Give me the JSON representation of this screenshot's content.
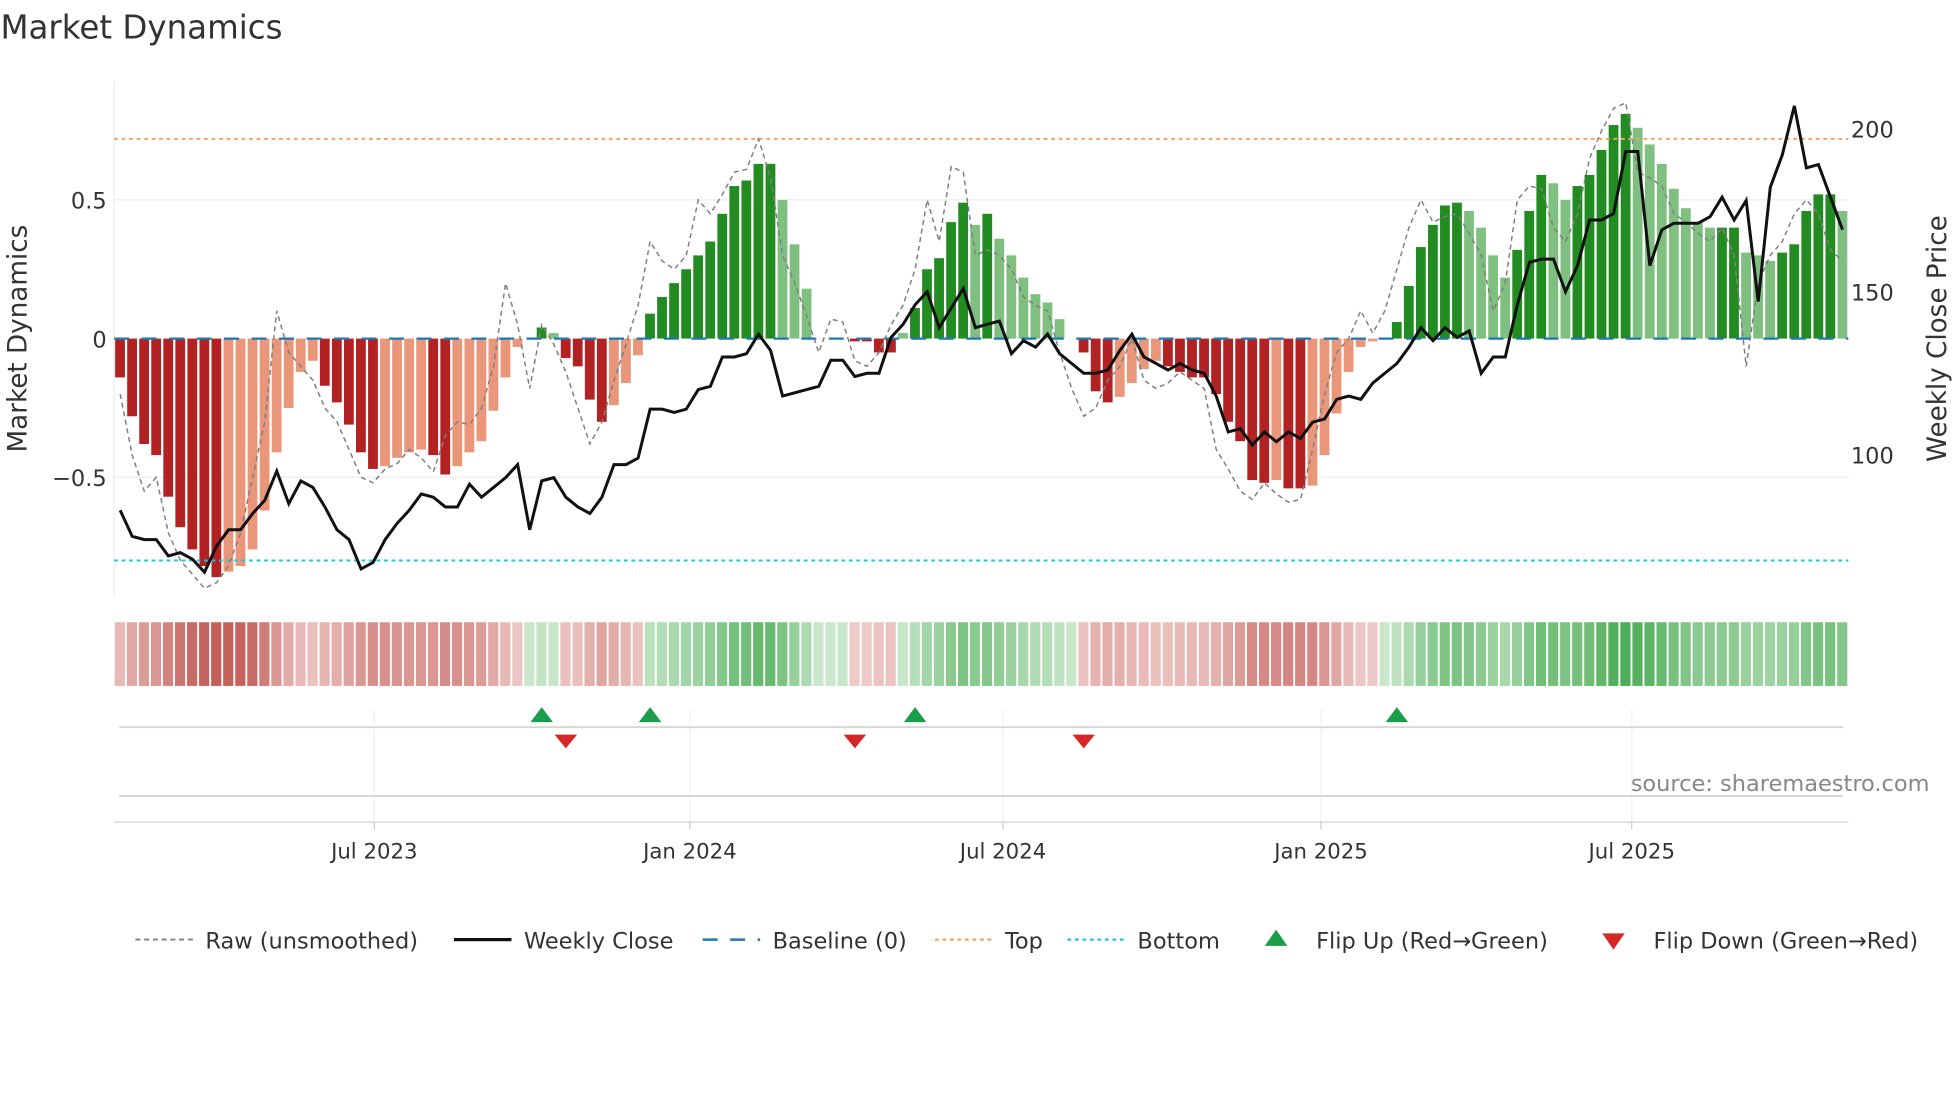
{
  "chart_data": {
    "type": "bar",
    "title": "Market Dynamics",
    "ylabel": "Market Dynamics",
    "ylabel_right": "Weekly Close Price",
    "ylim": [
      -0.94,
      0.95
    ],
    "ylim_right": [
      60,
      215
    ],
    "yticks": [
      {
        "v": 0.5,
        "label": "0.5"
      },
      {
        "v": 0,
        "label": "0"
      },
      {
        "v": -0.5,
        "label": "−0.5"
      }
    ],
    "yticks_right": [
      {
        "v": 200,
        "label": "200"
      },
      {
        "v": 150,
        "label": "150"
      },
      {
        "v": 100,
        "label": "100"
      }
    ],
    "xticks": [
      {
        "week": 21.6,
        "label": "Jul 2023"
      },
      {
        "week": 47.8,
        "label": "Jan 2024"
      },
      {
        "week": 73.8,
        "label": "Jul 2024"
      },
      {
        "week": 100.2,
        "label": "Jan 2025"
      },
      {
        "week": 126.0,
        "label": "Jul 2025"
      }
    ],
    "top_level": 0.72,
    "bottom_level": -0.8,
    "baseline": 0,
    "source": "source: sharemaestro.com",
    "smoothed": [
      -0.14,
      -0.28,
      -0.38,
      -0.42,
      -0.57,
      -0.68,
      -0.76,
      -0.82,
      -0.86,
      -0.84,
      -0.82,
      -0.76,
      -0.62,
      -0.41,
      -0.25,
      -0.12,
      -0.08,
      -0.17,
      -0.23,
      -0.31,
      -0.41,
      -0.47,
      -0.46,
      -0.43,
      -0.41,
      -0.4,
      -0.42,
      -0.49,
      -0.46,
      -0.41,
      -0.37,
      -0.26,
      -0.14,
      -0.03,
      0.0,
      0.04,
      0.02,
      -0.07,
      -0.1,
      -0.22,
      -0.3,
      -0.24,
      -0.16,
      -0.06,
      0.09,
      0.15,
      0.2,
      0.25,
      0.3,
      0.35,
      0.45,
      0.55,
      0.57,
      0.63,
      0.63,
      0.5,
      0.34,
      0.18,
      0.0,
      0.0,
      0.0,
      -0.01,
      -0.01,
      -0.05,
      -0.05,
      0.02,
      0.11,
      0.25,
      0.29,
      0.42,
      0.49,
      0.41,
      0.45,
      0.36,
      0.3,
      0.22,
      0.16,
      0.13,
      0.07,
      0.0,
      -0.05,
      -0.19,
      -0.23,
      -0.21,
      -0.16,
      -0.11,
      -0.08,
      -0.1,
      -0.12,
      -0.14,
      -0.14,
      -0.2,
      -0.3,
      -0.37,
      -0.51,
      -0.52,
      -0.51,
      -0.54,
      -0.54,
      -0.53,
      -0.42,
      -0.27,
      -0.12,
      -0.03,
      -0.01,
      0.0,
      0.06,
      0.19,
      0.33,
      0.41,
      0.48,
      0.49,
      0.46,
      0.4,
      0.3,
      0.22,
      0.32,
      0.46,
      0.59,
      0.56,
      0.5,
      0.55,
      0.59,
      0.68,
      0.77,
      0.81,
      0.76,
      0.7,
      0.63,
      0.54,
      0.47,
      0.42,
      0.4,
      0.4,
      0.4,
      0.31,
      0.3,
      0.28,
      0.31,
      0.34,
      0.46,
      0.52,
      0.52,
      0.46
    ],
    "raw": [
      -0.2,
      -0.42,
      -0.55,
      -0.5,
      -0.7,
      -0.8,
      -0.85,
      -0.9,
      -0.88,
      -0.82,
      -0.7,
      -0.5,
      -0.3,
      0.1,
      -0.05,
      -0.1,
      -0.15,
      -0.25,
      -0.3,
      -0.4,
      -0.5,
      -0.52,
      -0.47,
      -0.45,
      -0.4,
      -0.43,
      -0.48,
      -0.35,
      -0.3,
      -0.31,
      -0.25,
      -0.1,
      0.2,
      0.05,
      -0.18,
      0.05,
      -0.02,
      -0.12,
      -0.25,
      -0.38,
      -0.3,
      -0.15,
      -0.02,
      0.12,
      0.35,
      0.28,
      0.25,
      0.3,
      0.5,
      0.45,
      0.52,
      0.6,
      0.61,
      0.72,
      0.58,
      0.3,
      0.2,
      0.08,
      -0.05,
      0.07,
      0.06,
      -0.08,
      -0.1,
      -0.05,
      0.05,
      0.12,
      0.25,
      0.5,
      0.35,
      0.62,
      0.6,
      0.3,
      0.32,
      0.3,
      0.25,
      0.15,
      0.12,
      0.1,
      -0.05,
      -0.18,
      -0.28,
      -0.25,
      -0.15,
      -0.1,
      0.0,
      -0.15,
      -0.18,
      -0.16,
      -0.12,
      -0.15,
      -0.18,
      -0.4,
      -0.47,
      -0.55,
      -0.58,
      -0.52,
      -0.56,
      -0.59,
      -0.58,
      -0.4,
      -0.2,
      -0.05,
      0.0,
      0.1,
      0.02,
      0.1,
      0.25,
      0.4,
      0.5,
      0.42,
      0.44,
      0.45,
      0.38,
      0.3,
      0.1,
      0.2,
      0.5,
      0.55,
      0.54,
      0.4,
      0.35,
      0.45,
      0.65,
      0.75,
      0.83,
      0.85,
      0.6,
      0.58,
      0.55,
      0.45,
      0.42,
      0.38,
      0.35,
      0.4,
      0.3,
      -0.1,
      0.2,
      0.3,
      0.35,
      0.45,
      0.5,
      0.45,
      0.32,
      0.28
    ],
    "weekly_close": [
      83,
      75,
      74,
      74,
      69,
      70,
      68,
      64,
      72,
      77,
      77,
      82,
      86,
      95,
      85,
      92,
      90,
      84,
      77,
      74,
      65,
      67,
      74,
      79,
      83,
      88,
      87,
      84,
      84,
      91,
      87,
      90,
      93,
      97,
      77,
      92,
      93,
      87,
      84,
      82,
      87,
      97,
      97,
      99,
      114,
      114,
      113,
      114,
      120,
      121,
      130,
      130,
      131,
      137,
      132,
      118,
      119,
      120,
      121,
      129,
      129,
      124,
      125,
      125,
      136,
      140,
      146,
      150,
      139,
      145,
      151,
      139,
      140,
      141,
      131,
      135,
      133,
      137,
      131,
      128,
      125,
      125,
      126,
      132,
      137,
      130,
      128,
      126,
      128,
      126,
      125,
      118,
      107,
      108,
      103,
      107,
      104,
      107,
      105,
      110,
      111,
      117,
      118,
      117,
      122,
      125,
      128,
      133,
      139,
      135,
      139,
      136,
      138,
      125,
      130,
      130,
      146,
      159,
      160,
      160,
      150,
      158,
      172,
      172,
      174,
      193,
      193,
      158,
      169,
      171,
      171,
      171,
      173,
      179,
      172,
      178,
      147,
      182,
      192,
      207,
      188,
      189,
      179,
      169
    ],
    "flip_up_weeks": [
      35,
      44,
      66,
      106
    ],
    "flip_down_weeks": [
      37,
      61,
      80
    ],
    "legend": [
      {
        "label": "Raw (unsmoothed)",
        "style": "raw"
      },
      {
        "label": "Weekly Close",
        "style": "close"
      },
      {
        "label": "Baseline (0)",
        "style": "baseline"
      },
      {
        "label": "Top",
        "style": "top"
      },
      {
        "label": "Bottom",
        "style": "bottom"
      },
      {
        "label": "Flip Up (Red→Green)",
        "style": "up"
      },
      {
        "label": "Flip Down (Green→Red)",
        "style": "down"
      }
    ],
    "colors": {
      "green_dark": "#228b22",
      "green_light": "#7fbf7f",
      "red_dark": "#b22222",
      "red_light": "#e9967a",
      "top": "#f4a460",
      "bottom": "#1ec8d8",
      "baseline": "#1f77b4",
      "flip_up": "#1a9e4a",
      "flip_down": "#d62728",
      "raw": "#808080",
      "close": "#111111"
    }
  }
}
